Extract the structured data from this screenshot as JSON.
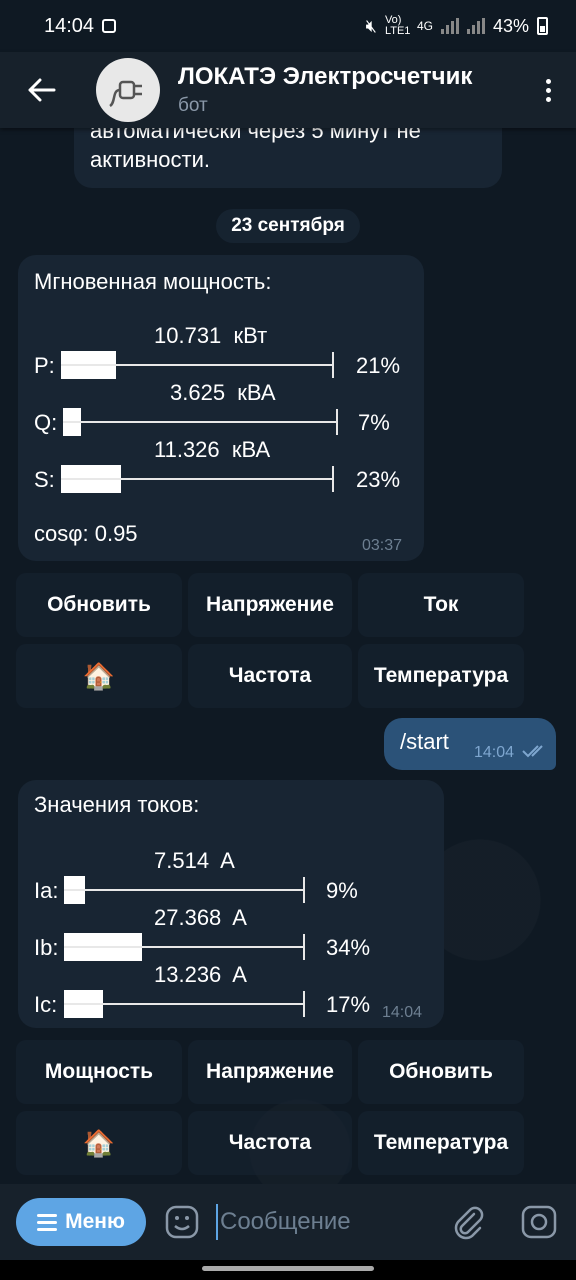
{
  "status_bar": {
    "time": "14:04",
    "network": "Vo) LTE1",
    "network_type": "4G",
    "battery": "43%"
  },
  "header": {
    "title": "ЛОКАТЭ Электросчетчик",
    "subtitle": "бот",
    "icons": [
      "back-arrow-icon",
      "plug-icon",
      "more-vert-icon"
    ]
  },
  "prev_message": {
    "line1": "автоматически через 5 минут не",
    "line2": "активности."
  },
  "date_chip": "23 сентября",
  "power_message": {
    "title": "Мгновенная мощность:",
    "rows": [
      {
        "label": "P:",
        "value": "10.731  кВт",
        "percent": "21%",
        "fill": 0.21
      },
      {
        "label": "Q:",
        "value": "3.625  кВА",
        "percent": "7%",
        "fill": 0.07
      },
      {
        "label": "S:",
        "value": "11.326  кВА",
        "percent": "23%",
        "fill": 0.23
      }
    ],
    "cosphi": "cosφ: 0.95",
    "time": "03:37"
  },
  "keyboard_1": {
    "buttons": [
      "Обновить",
      "Напряжение",
      "Ток",
      "🏠",
      "Частота",
      "Температура"
    ]
  },
  "out_message": {
    "text": "/start",
    "time": "14:04"
  },
  "currents_message": {
    "title": "Значения токов:",
    "rows": [
      {
        "label": "Ia:",
        "value": "7.514  A",
        "percent": "9%",
        "fill": 0.09
      },
      {
        "label": "Ib:",
        "value": "27.368  A",
        "percent": "34%",
        "fill": 0.34
      },
      {
        "label": "Ic:",
        "value": "13.236  A",
        "percent": "17%",
        "fill": 0.17
      }
    ],
    "time": "14:04"
  },
  "keyboard_2": {
    "buttons": [
      "Мощность",
      "Напряжение",
      "Обновить",
      "🏠",
      "Частота",
      "Температура"
    ]
  },
  "input_bar": {
    "menu_label": "Меню",
    "placeholder": "Сообщение"
  },
  "colors": {
    "background": "#0e1621",
    "bubble_in": "#182533",
    "bubble_out": "#2b5278",
    "accent": "#5ea5e4"
  }
}
